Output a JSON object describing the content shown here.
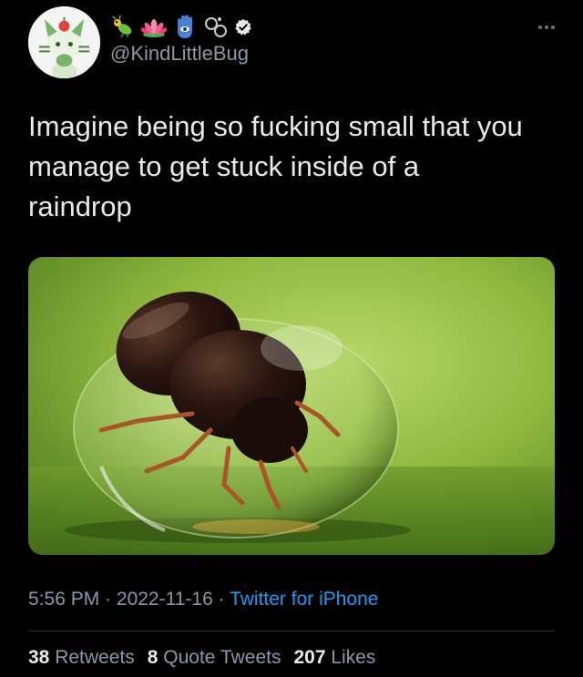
{
  "author": {
    "handle": "@KindLittleBug",
    "display_name_emojis": [
      "bug-emoji",
      "lotus-emoji",
      "hamsa-emoji",
      "rings-emoji"
    ],
    "verified": true
  },
  "tweet": {
    "text": "Imagine being so fucking small that you\nmanage to get stuck inside of a\nraindrop"
  },
  "meta": {
    "time": "5:56 PM",
    "separator1": " · ",
    "date": "2022-11-16",
    "separator2": " · ",
    "source": "Twitter for iPhone"
  },
  "stats": {
    "retweets_count": "38",
    "retweets_label": "Retweets",
    "quotes_count": "8",
    "quotes_label": "Quote Tweets",
    "likes_count": "207",
    "likes_label": "Likes"
  },
  "colors": {
    "background": "#000000",
    "text": "#e7e9ea",
    "secondary": "#8b98a5",
    "link": "#1d9bf0",
    "verified": "#e7e9ea"
  }
}
